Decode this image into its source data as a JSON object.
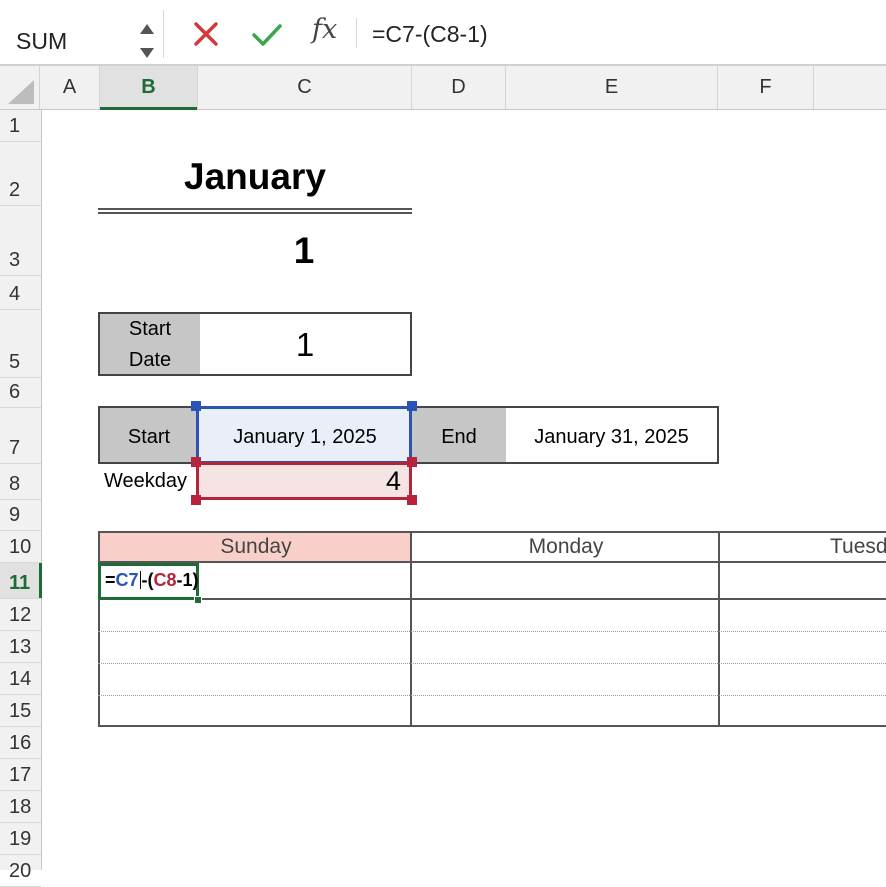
{
  "formula_bar": {
    "name_box": "SUM",
    "fx_label": "fx",
    "formula": "=C7-(C8-1)"
  },
  "columns": [
    "A",
    "B",
    "C",
    "D",
    "E",
    "F"
  ],
  "active_column": "B",
  "rows": [
    "1",
    "2",
    "3",
    "4",
    "5",
    "6",
    "7",
    "8",
    "9",
    "10",
    "11",
    "12",
    "13",
    "14",
    "15",
    "16",
    "17",
    "18",
    "19",
    "20"
  ],
  "active_row": "11",
  "sheet": {
    "title": "January",
    "month_number": "1",
    "start_date_label_line1": "Start",
    "start_date_label_line2": "Date",
    "start_date_value": "1",
    "start_label": "Start",
    "start_value": "January 1, 2025",
    "end_label": "End",
    "end_value": "January 31, 2025",
    "weekday_label": "Weekday",
    "weekday_value": "4"
  },
  "calendar": {
    "days": [
      "Sunday",
      "Monday",
      "Tuesday"
    ],
    "highlight_color": "#f9d0c9"
  },
  "active_cell": {
    "parts": [
      "=",
      "C7",
      "-",
      "(",
      "C8",
      "-1)"
    ]
  },
  "colors": {
    "ref_blue": "#2a55b5",
    "ref_red": "#b5243a",
    "excel_green": "#1e6b35"
  }
}
